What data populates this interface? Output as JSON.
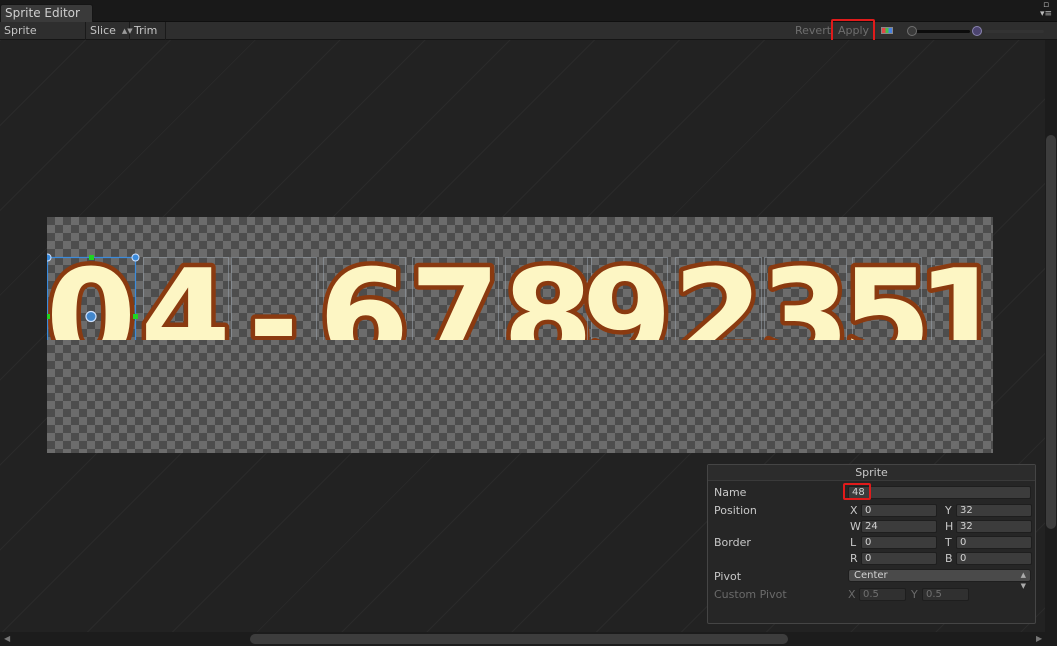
{
  "window": {
    "tab_title": "Sprite Editor",
    "window_menu_icon": "window-menu-icon"
  },
  "toolbar": {
    "mode_label": "Sprite Editor",
    "slice_label": "Slice",
    "trim_label": "Trim",
    "revert_label": "Revert",
    "apply_label": "Apply",
    "color_channel_icon": "color-channel-icon",
    "zoom_slider": 0.0,
    "mip_slider": 0.0
  },
  "sprite_sheet": {
    "glyphs": [
      "0",
      "4",
      "-",
      "6",
      "7",
      "8",
      "9",
      "2",
      "3",
      "5",
      "1"
    ],
    "selected_index": 0,
    "colors": {
      "fill": "#fdf6c4",
      "outline": "#8a3a10",
      "selection": "#3b8bdc",
      "handle": "#21d421"
    }
  },
  "sprite_panel": {
    "title": "Sprite",
    "name_label": "Name",
    "name_value": "48",
    "position_label": "Position",
    "x_label": "X",
    "x_value": "0",
    "y_label": "Y",
    "y_value": "32",
    "w_label": "W",
    "w_value": "24",
    "h_label": "H",
    "h_value": "32",
    "border_label": "Border",
    "l_label": "L",
    "l_value": "0",
    "t_label": "T",
    "t_value": "0",
    "r_label": "R",
    "r_value": "0",
    "b_label": "B",
    "b_value": "0",
    "pivot_label": "Pivot",
    "pivot_value": "Center",
    "custom_pivot_label": "Custom Pivot",
    "cp_x_label": "X",
    "cp_x_value": "0.5",
    "cp_y_label": "Y",
    "cp_y_value": "0.5"
  }
}
